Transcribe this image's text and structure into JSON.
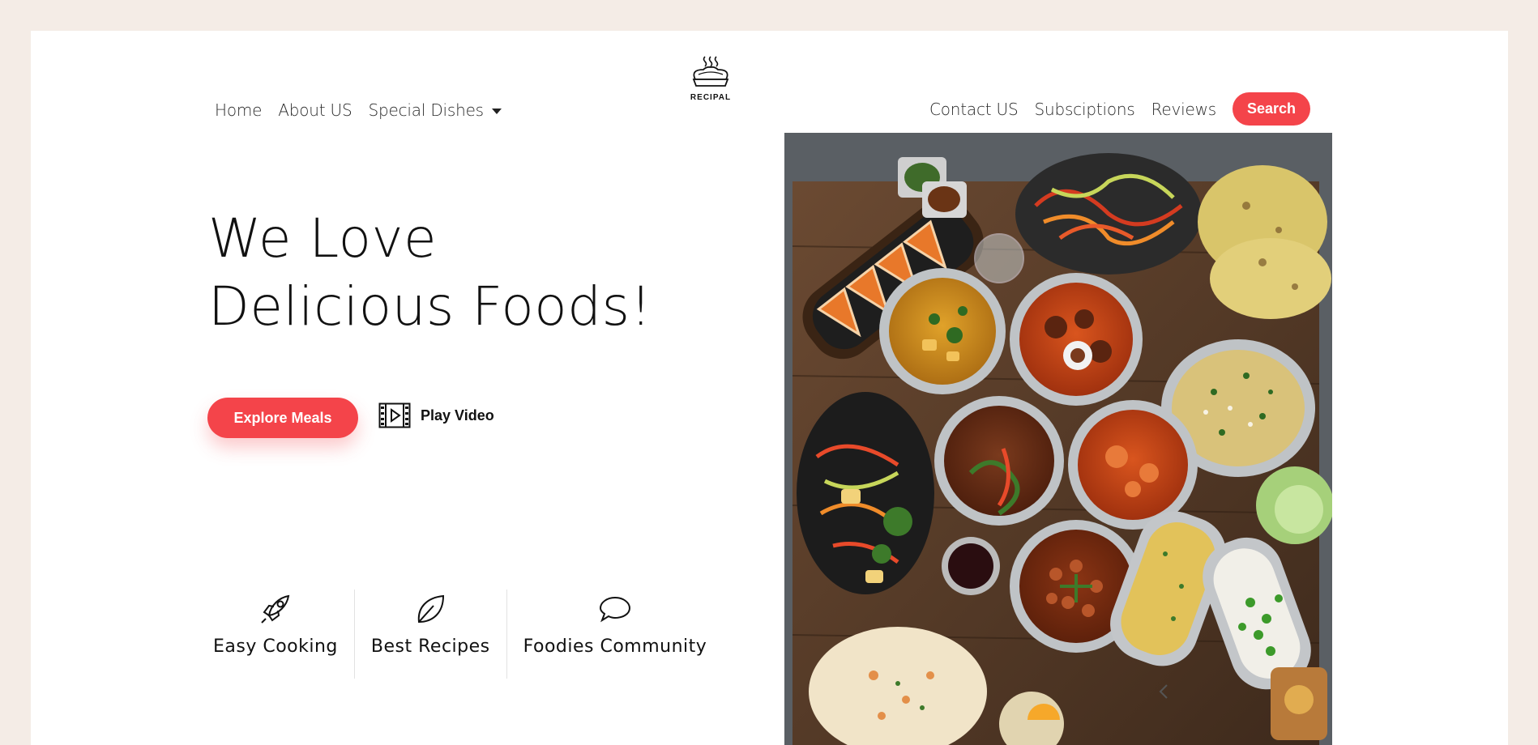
{
  "nav": {
    "left": [
      {
        "label": "Home"
      },
      {
        "label": "About US"
      },
      {
        "label": "Special Dishes"
      }
    ],
    "right": [
      {
        "label": "Contact US"
      },
      {
        "label": "Subsciptions"
      },
      {
        "label": "Reviews"
      }
    ],
    "search_label": "Search"
  },
  "logo": {
    "text": "RECIPAL",
    "icon": "chef-pie-icon"
  },
  "hero": {
    "title_line1": "We Love",
    "title_line2": "Delicious Foods!",
    "explore_label": "Explore Meals",
    "play_label": "Play Video",
    "image_alt": "food-spread-image"
  },
  "features": [
    {
      "label": "Easy Cooking",
      "icon": "rocket-icon"
    },
    {
      "label": "Best Recipes",
      "icon": "leaf-icon"
    },
    {
      "label": "Foodies Community",
      "icon": "chat-bubble-icon"
    }
  ],
  "colors": {
    "accent": "#f4444a",
    "page_background": "#f4ece6",
    "card_background": "#ffffff"
  }
}
